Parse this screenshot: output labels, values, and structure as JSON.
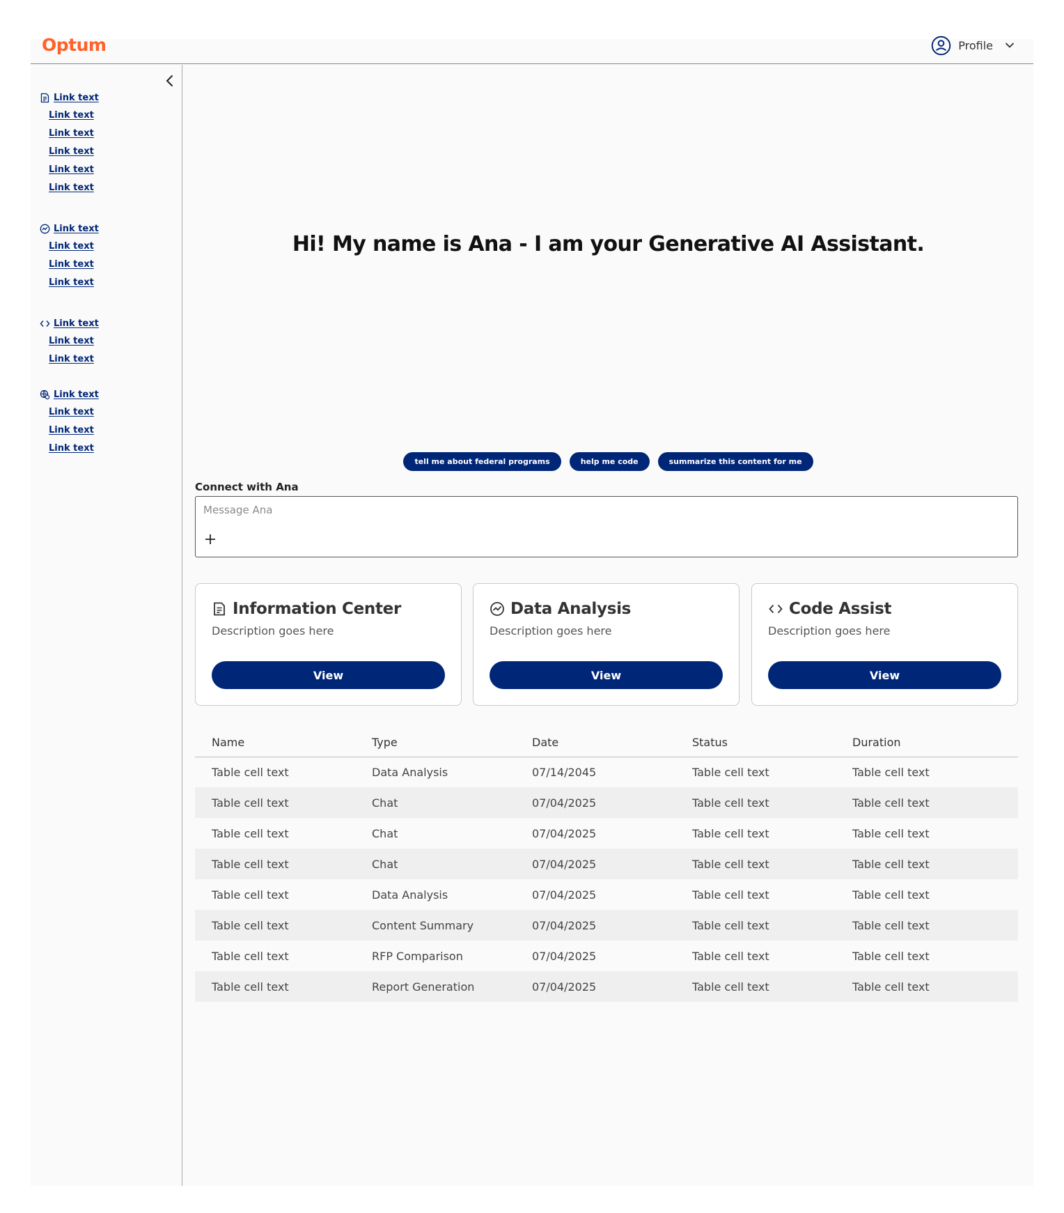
{
  "header": {
    "logo": "Optum",
    "profile_label": "Profile",
    "profile_icon": "user-circle-icon",
    "chevron_icon": "chevron-down-icon"
  },
  "colors": {
    "brand_orange": "#ff612b",
    "primary_navy": "#002677"
  },
  "sidebar": {
    "collapse_icon": "chevron-left-icon",
    "groups": [
      {
        "icon": "document-icon",
        "label": "Link text",
        "items": [
          "Link text",
          "Link text",
          "Link text",
          "Link text",
          "Link text"
        ]
      },
      {
        "icon": "chart-icon",
        "label": "Link text",
        "items": [
          "Link text",
          "Link text",
          "Link text"
        ]
      },
      {
        "icon": "code-icon",
        "label": "Link text",
        "items": [
          "Link text",
          "Link text"
        ]
      },
      {
        "icon": "search-globe-icon",
        "label": "Link text",
        "items": [
          "Link text",
          "Link text",
          "Link text"
        ]
      }
    ]
  },
  "main": {
    "hero_title": "Hi! My name is Ana - I am your Generative AI Assistant.",
    "chips": [
      "tell me about federal programs",
      "help me code",
      "summarize this content for me"
    ],
    "connect_label": "Connect with Ana",
    "message_placeholder": "Message Ana",
    "plus_icon": "plus-icon"
  },
  "cards": [
    {
      "icon": "document-icon",
      "title": "Information Center",
      "description": "Description goes here",
      "button": "View"
    },
    {
      "icon": "chart-icon",
      "title": "Data Analysis",
      "description": "Description goes here",
      "button": "View"
    },
    {
      "icon": "code-icon",
      "title": "Code Assist",
      "description": "Description goes here",
      "button": "View"
    }
  ],
  "table": {
    "columns": [
      "Name",
      "Type",
      "Date",
      "Status",
      "Duration"
    ],
    "rows": [
      [
        "Table cell text",
        "Data Analysis",
        "07/14/2045",
        "Table cell text",
        "Table cell text"
      ],
      [
        "Table cell text",
        "Chat",
        "07/04/2025",
        "Table cell text",
        "Table cell text"
      ],
      [
        "Table cell text",
        "Chat",
        "07/04/2025",
        "Table cell text",
        "Table cell text"
      ],
      [
        "Table cell text",
        "Chat",
        "07/04/2025",
        "Table cell text",
        "Table cell text"
      ],
      [
        "Table cell text",
        "Data Analysis",
        "07/04/2025",
        "Table cell text",
        "Table cell text"
      ],
      [
        "Table cell text",
        "Content Summary",
        "07/04/2025",
        "Table cell text",
        "Table cell text"
      ],
      [
        "Table cell text",
        "RFP Comparison",
        "07/04/2025",
        "Table cell text",
        "Table cell text"
      ],
      [
        "Table cell text",
        "Report Generation",
        "07/04/2025",
        "Table cell text",
        "Table cell text"
      ]
    ]
  }
}
